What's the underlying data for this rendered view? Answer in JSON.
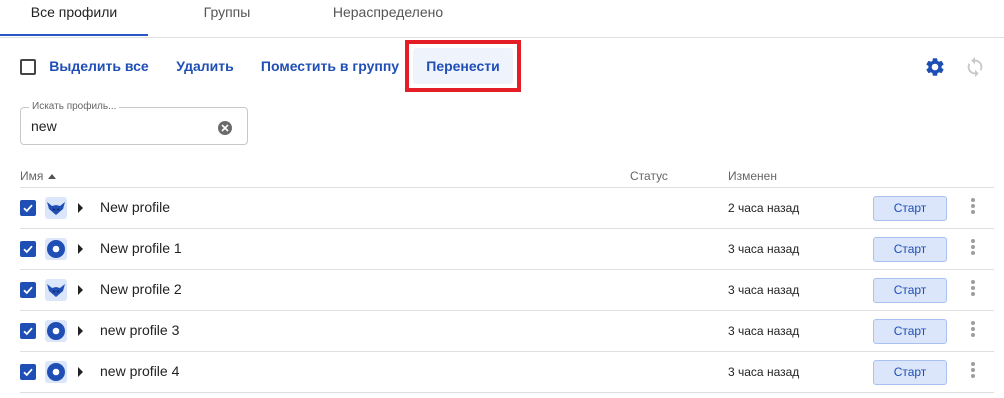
{
  "tabs": [
    {
      "label": "Все профили",
      "active": true
    },
    {
      "label": "Группы",
      "active": false
    },
    {
      "label": "Нераспределено",
      "active": false
    }
  ],
  "toolbar": {
    "select_all": "Выделить все",
    "delete": "Удалить",
    "move_to_group": "Поместить в группу",
    "transfer": "Перенести",
    "settings_icon": "gear-icon",
    "refresh_icon": "refresh-icon"
  },
  "search": {
    "label": "Искать профиль...",
    "value": "new"
  },
  "table": {
    "headers": {
      "name": "Имя",
      "status": "Статус",
      "changed": "Изменен"
    },
    "rows": [
      {
        "name": "New profile",
        "changed": "2 часа назад",
        "icon": "fox-icon",
        "checked": true,
        "action": "Старт"
      },
      {
        "name": "New profile 1",
        "changed": "3 часа назад",
        "icon": "circle-icon",
        "checked": true,
        "action": "Старт"
      },
      {
        "name": "New profile 2",
        "changed": "3 часа назад",
        "icon": "fox-icon",
        "checked": true,
        "action": "Старт"
      },
      {
        "name": "new profile 3",
        "changed": "3 часа назад",
        "icon": "circle-icon",
        "checked": true,
        "action": "Старт"
      },
      {
        "name": "new profile 4",
        "changed": "3 часа назад",
        "icon": "circle-icon",
        "checked": true,
        "action": "Старт"
      }
    ]
  },
  "colors": {
    "accent": "#1f4fb5",
    "highlight": "#e41e26",
    "button_bg": "#dbe6fa"
  }
}
